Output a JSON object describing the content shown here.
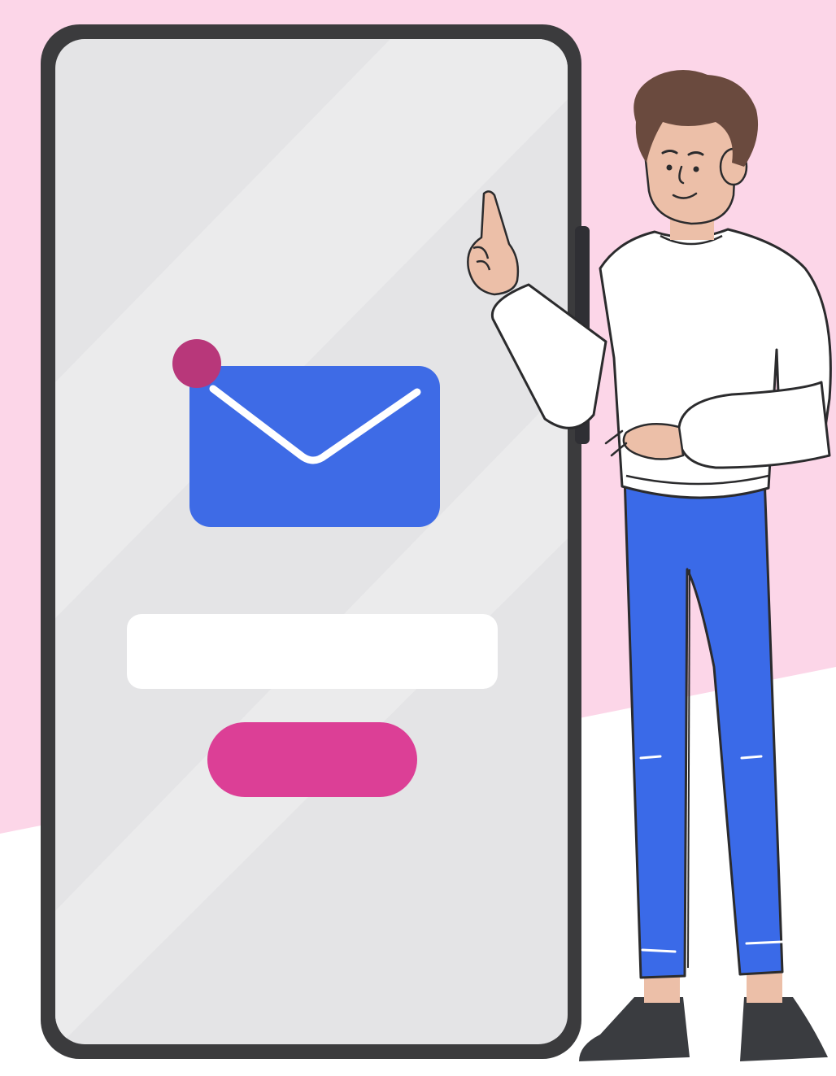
{
  "scene": {
    "subject": "email-subscription-illustration",
    "colors": {
      "background_pink": "#fcd6e8",
      "background_white": "#ffffff",
      "phone_frame": "#3b3b3d",
      "phone_screen": "#e4e4e6",
      "envelope": "#3e6be6",
      "notification_dot": "#b8377a",
      "input_field": "#ffffff",
      "submit_button": "#dc3f96",
      "shirt": "#ffffff",
      "pants": "#3a6ae8",
      "hair": "#6a4a3e",
      "skin": "#ecbfa8",
      "shoes": "#3a3c40",
      "outline": "#2b2b2d"
    },
    "phone": {
      "icon": "envelope-icon",
      "notification_badge": true,
      "email_input_value": "",
      "submit_button_label": ""
    },
    "person": {
      "gesture": "pointing-up"
    }
  }
}
